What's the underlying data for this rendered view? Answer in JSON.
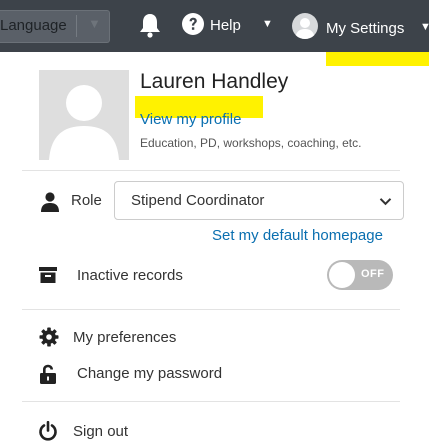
{
  "topbar": {
    "language_label": "Language",
    "help_label": "Help",
    "settings_label": "My Settings",
    "background_color": "#3d434a"
  },
  "profile": {
    "name": "Lauren Handley",
    "view_profile_link": "View my profile",
    "subtitle": "Education, PD, workshops, coaching, etc."
  },
  "role": {
    "label": "Role",
    "selected": "Stipend Coordinator",
    "default_homepage_link": "Set my default homepage"
  },
  "inactive_records": {
    "label": "Inactive records",
    "toggle_state": "OFF"
  },
  "menu": {
    "preferences": "My preferences",
    "change_password": "Change my password",
    "sign_out": "Sign out"
  },
  "colors": {
    "link": "#0a6fb0",
    "highlight": "#fff200",
    "toggle_off": "#b9b9b9"
  },
  "icons": {
    "bell": "bell-icon",
    "help": "question-circle-icon",
    "avatar": "user-avatar-icon",
    "role": "person-icon",
    "inactive": "archive-icon",
    "preferences": "gear-icon",
    "password": "unlock-icon",
    "signout": "power-icon"
  }
}
